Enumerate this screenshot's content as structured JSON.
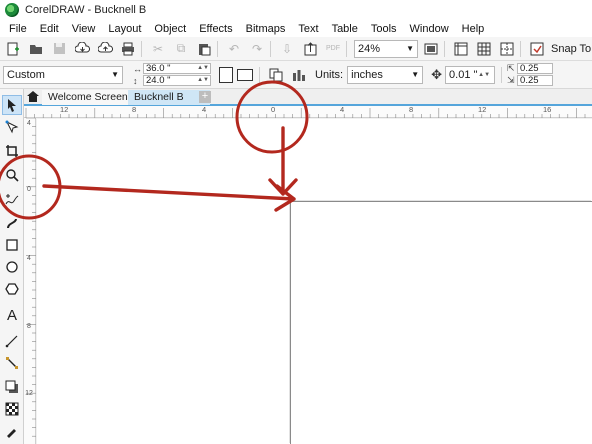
{
  "window": {
    "title": "CorelDRAW - Bucknell B"
  },
  "menu": {
    "items": [
      "File",
      "Edit",
      "View",
      "Layout",
      "Object",
      "Effects",
      "Bitmaps",
      "Text",
      "Table",
      "Tools",
      "Window",
      "Help"
    ]
  },
  "standard_toolbar": {
    "zoom_value": "24%",
    "snap_label": "Snap To"
  },
  "property_bar": {
    "preset": "Custom",
    "width": "36.0 \"",
    "height": "24.0 \"",
    "units_label": "Units:",
    "units_value": "inches",
    "nudge_value": "0.01 \"",
    "duplicate_x": "0.25",
    "duplicate_y": "0.25"
  },
  "tabs": [
    {
      "label": "Welcome Screen"
    },
    {
      "label": "Bucknell B"
    }
  ],
  "rulers": {
    "horizontal_labels": [
      "12",
      "8",
      "4",
      "0",
      "4",
      "8",
      "12",
      "16"
    ],
    "vertical_labels": [
      "4",
      "0",
      "4",
      "8",
      "12"
    ]
  },
  "annotations": {
    "color": "#b3281e"
  },
  "icons": {
    "app": "coreldraw-logo",
    "home": "home-icon",
    "add_tab": "plus-icon"
  }
}
